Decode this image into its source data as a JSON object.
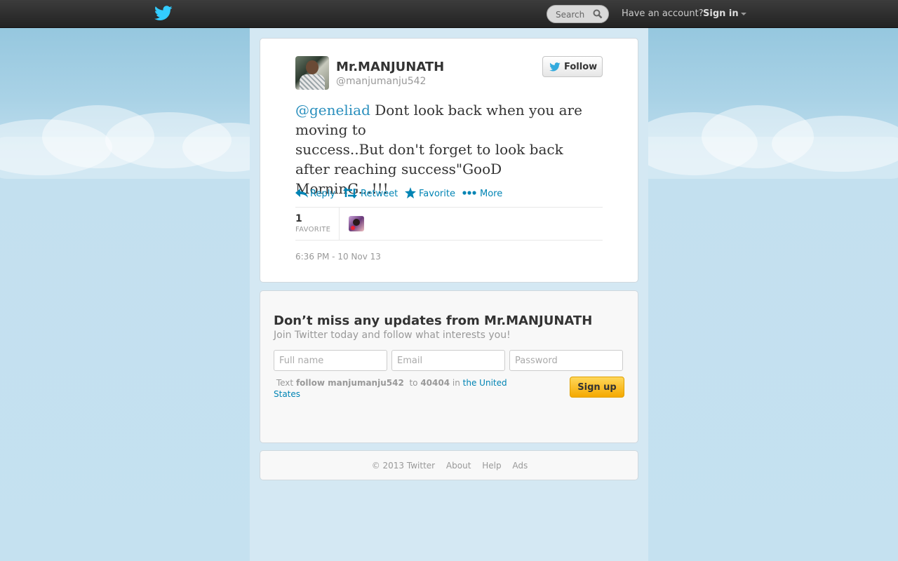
{
  "topbar": {
    "search_placeholder": "Search",
    "have_account": "Have an account?",
    "sign_in": "Sign in"
  },
  "tweet": {
    "name": "Mr.MANJUNATH",
    "handle": "@manjumanju542",
    "follow_label": "Follow",
    "mention": "@geneliad",
    "text_line1": " Dont look back when you are",
    "text_line2": "moving to",
    "text_line3": "success..But don't forget to look back",
    "text_line4": "after reaching success\"GooD MorninG...!!!",
    "actions": {
      "reply": "Reply",
      "retweet": "Retweet",
      "favorite": "Favorite",
      "more": "More"
    },
    "favorite_count": "1",
    "favorite_label": "FAVORITE",
    "timestamp": "6:36 PM - 10 Nov 13"
  },
  "signup": {
    "title": "Don’t miss any updates from Mr.MANJUNATH",
    "subtitle": "Join Twitter today and follow what interests you!",
    "fullname_placeholder": "Full name",
    "email_placeholder": "Email",
    "password_placeholder": "Password",
    "sms_text": "Text",
    "sms_command": "follow manjumanju542",
    "sms_to": "to",
    "sms_number": "40404",
    "sms_in": "in",
    "sms_country": "the United States",
    "button": "Sign up"
  },
  "footer": {
    "copyright": "© 2013 Twitter",
    "about": "About",
    "help": "Help",
    "ads": "Ads"
  },
  "colors": {
    "link": "#0084b4",
    "mention": "#2a8fbd",
    "signup_button": "#f5a900"
  }
}
